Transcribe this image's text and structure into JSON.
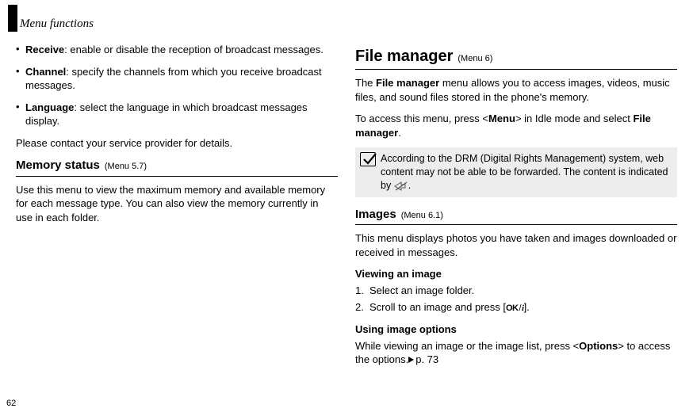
{
  "page_number": "62",
  "header": "Menu functions",
  "left": {
    "bullets": [
      {
        "term": "Receive",
        "desc": ": enable or disable the reception of broadcast messages."
      },
      {
        "term": "Channel",
        "desc": ": specify the channels from which you receive broadcast messages."
      },
      {
        "term": "Language",
        "desc": ": select the language in which broadcast messages display."
      }
    ],
    "contact_line": "Please contact your service provider for details.",
    "memory_status": {
      "title": "Memory status",
      "menu": "(Menu 5.7)",
      "body": "Use this menu to view the maximum memory and available memory for each message type. You can also view the memory currently in use in each folder."
    }
  },
  "right": {
    "file_manager": {
      "title": "File manager",
      "menu": "(Menu 6)",
      "p1a": "The ",
      "p1b": "File manager",
      "p1c": " menu allows you to access images, videos, music files, and sound files stored in the phone's memory.",
      "p2a": "To access this menu, press <",
      "p2b": "Menu",
      "p2c": "> in Idle mode and select ",
      "p2d": "File manager",
      "p2e": "."
    },
    "note": {
      "text_a": "According to the DRM (Digital Rights Management) system, web content may not be able to be forwarded. The content is indicated by ",
      "text_b": "."
    },
    "images": {
      "title": "Images",
      "menu": "(Menu 6.1)",
      "body": "This menu displays photos you have taken and images downloaded or received in messages."
    },
    "viewing": {
      "head": "Viewing an image",
      "s1": "Select an image folder.",
      "s2a": "Scroll to an image and press [",
      "s2b": "]."
    },
    "using": {
      "head": "Using image options",
      "p_a": "While viewing an image or the image list, press <",
      "p_b": "Options",
      "p_c": "> to access the options.",
      "ref": "p. 73"
    }
  }
}
